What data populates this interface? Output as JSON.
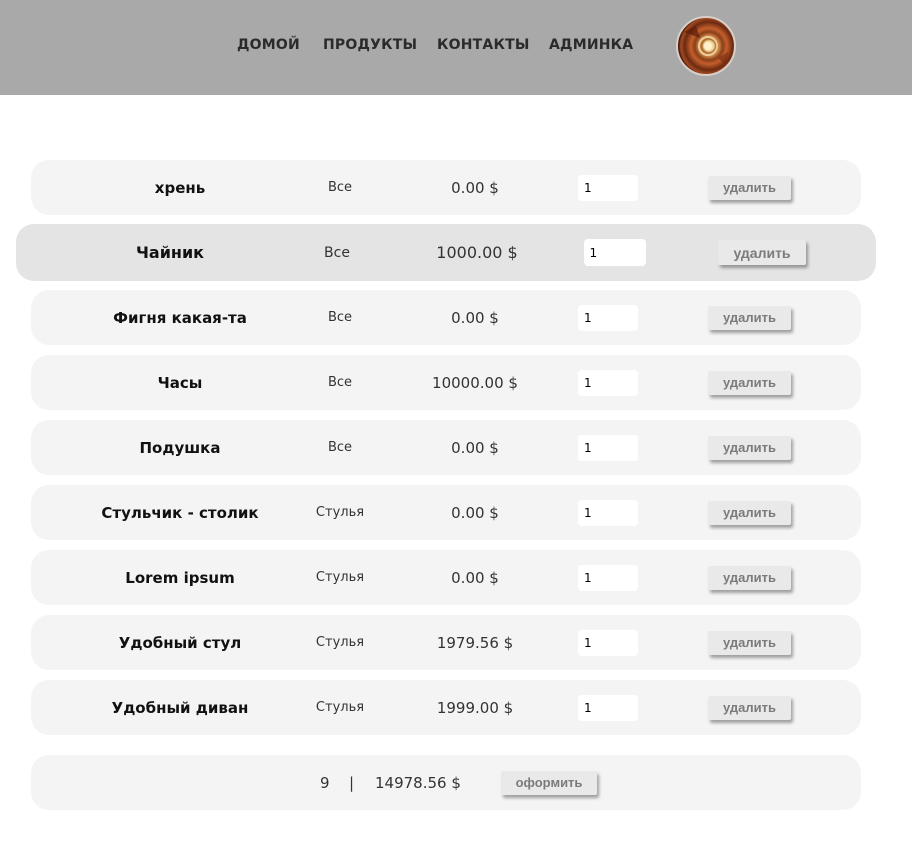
{
  "nav": {
    "items": [
      {
        "label": "ДОМОЙ"
      },
      {
        "label": "ПРОДУКТЫ"
      },
      {
        "label": "КОНТАКТЫ"
      },
      {
        "label": "АДМИНКА"
      }
    ]
  },
  "cart": {
    "items": [
      {
        "name": "хрень",
        "category": "Все",
        "price": "0.00 $",
        "qty": "1",
        "delete_label": "удалить"
      },
      {
        "name": "Чайник",
        "category": "Все",
        "price": "1000.00 $",
        "qty": "1",
        "delete_label": "удалить"
      },
      {
        "name": "Фигня какая-та",
        "category": "Все",
        "price": "0.00 $",
        "qty": "1",
        "delete_label": "удалить"
      },
      {
        "name": "Часы",
        "category": "Все",
        "price": "10000.00 $",
        "qty": "1",
        "delete_label": "удалить"
      },
      {
        "name": "Подушка",
        "category": "Все",
        "price": "0.00 $",
        "qty": "1",
        "delete_label": "удалить"
      },
      {
        "name": "Стульчик - столик",
        "category": "Стулья",
        "price": "0.00 $",
        "qty": "1",
        "delete_label": "удалить"
      },
      {
        "name": "Lorem ipsum",
        "category": "Стулья",
        "price": "0.00 $",
        "qty": "1",
        "delete_label": "удалить"
      },
      {
        "name": "Удобный стул",
        "category": "Стулья",
        "price": "1979.56 $",
        "qty": "1",
        "delete_label": "удалить"
      },
      {
        "name": "Удобный диван",
        "category": "Стулья",
        "price": "1999.00 $",
        "qty": "1",
        "delete_label": "удалить"
      }
    ]
  },
  "summary": {
    "count": "9",
    "separator": "|",
    "total": "14978.56 $",
    "checkout_label": "оформить"
  }
}
